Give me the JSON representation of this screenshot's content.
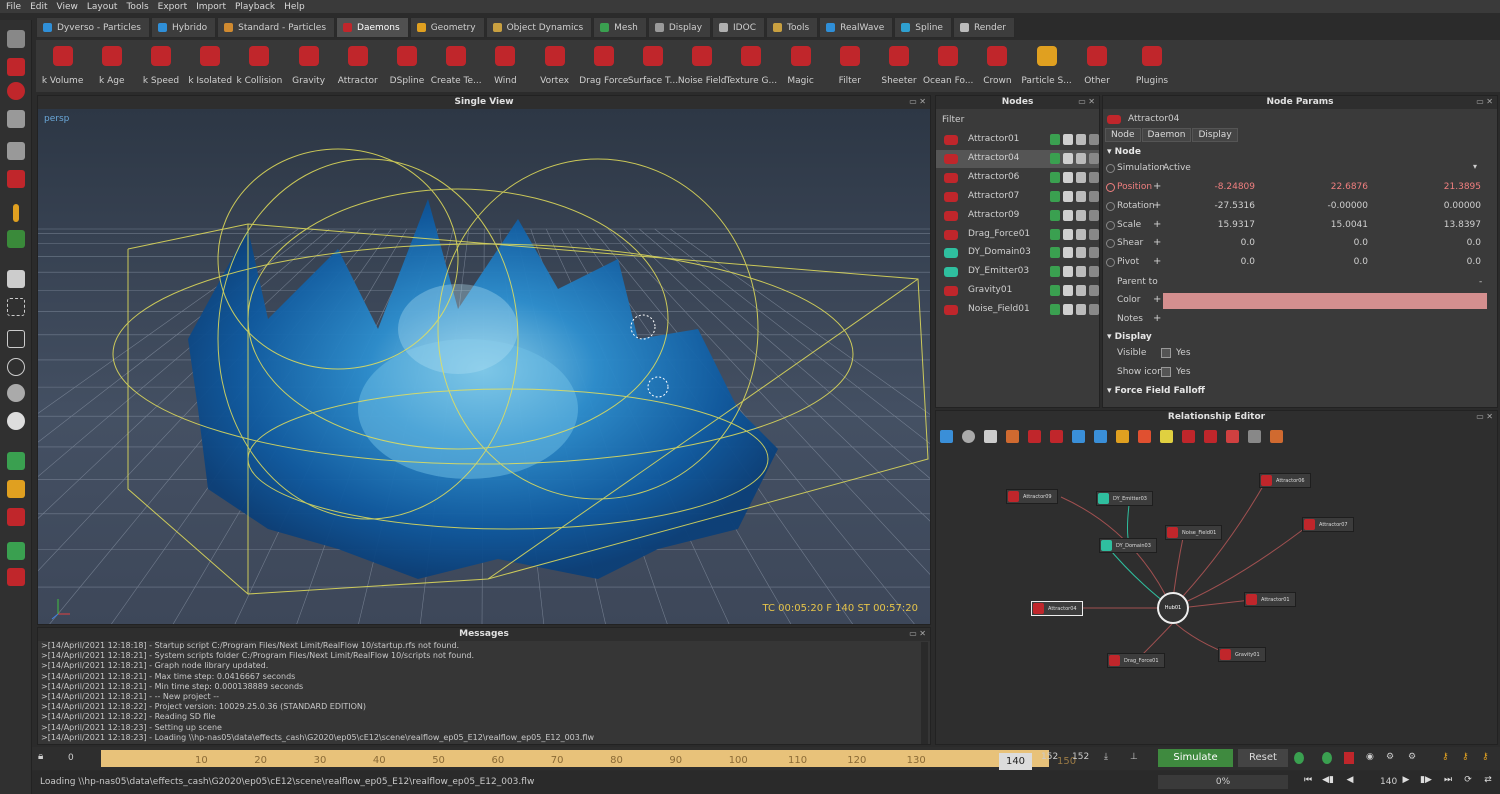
{
  "menu": [
    "File",
    "Edit",
    "View",
    "Layout",
    "Tools",
    "Export",
    "Import",
    "Playback",
    "Help"
  ],
  "shelf_tabs": [
    {
      "label": "Dyverso - Particles",
      "icon": "dyverso-icon",
      "color": "#2f8fd8"
    },
    {
      "label": "Hybrido",
      "icon": "hybrido-icon",
      "color": "#2f8fd8"
    },
    {
      "label": "Standard - Particles",
      "icon": "particles-icon",
      "color": "#d08a30"
    },
    {
      "label": "Daemons",
      "icon": "daemon-icon",
      "color": "#c0262b"
    },
    {
      "label": "Geometry",
      "icon": "geometry-icon",
      "color": "#e0a020"
    },
    {
      "label": "Object Dynamics",
      "icon": "object-dynamics-icon",
      "color": "#c9a040"
    },
    {
      "label": "Mesh",
      "icon": "mesh-icon",
      "color": "#3aa050"
    },
    {
      "label": "Display",
      "icon": "display-icon",
      "color": "#9a9a9a"
    },
    {
      "label": "IDOC",
      "icon": "idoc-icon",
      "color": "#b0b0b0"
    },
    {
      "label": "Tools",
      "icon": "tools-icon",
      "color": "#c9a040"
    },
    {
      "label": "RealWave",
      "icon": "realwave-icon",
      "color": "#2f8fd8"
    },
    {
      "label": "Spline",
      "icon": "spline-icon",
      "color": "#2fa0d0"
    },
    {
      "label": "Render",
      "icon": "render-icon",
      "color": "#bbbbbb"
    }
  ],
  "daemons": [
    "k Volume",
    "k Age",
    "k Speed",
    "k Isolated",
    "k Collision",
    "Gravity",
    "Attractor",
    "DSpline",
    "Create Te...",
    "Wind",
    "Vortex",
    "Drag Force",
    "Surface T...",
    "Noise Field",
    "Texture G...",
    "Magic",
    "Filter",
    "Sheeter",
    "Ocean Fo...",
    "Crown",
    "Particle S...",
    "Other",
    "Plugins"
  ],
  "viewport": {
    "title": "Single View",
    "camera": "persp",
    "timecode": "TC 00:05:20   F 140   ST 00:57:20"
  },
  "nodes": {
    "title": "Nodes",
    "filter_label": "Filter",
    "items": [
      {
        "label": "Attractor01",
        "type": "daemon"
      },
      {
        "label": "Attractor04",
        "type": "daemon",
        "selected": true
      },
      {
        "label": "Attractor06",
        "type": "daemon"
      },
      {
        "label": "Attractor07",
        "type": "daemon"
      },
      {
        "label": "Attractor09",
        "type": "daemon"
      },
      {
        "label": "Drag_Force01",
        "type": "daemon"
      },
      {
        "label": "DY_Domain03",
        "type": "dyverso"
      },
      {
        "label": "DY_Emitter03",
        "type": "dyverso"
      },
      {
        "label": "Gravity01",
        "type": "daemon"
      },
      {
        "label": "Noise_Field01",
        "type": "daemon"
      }
    ]
  },
  "params": {
    "title": "Node Params",
    "node_name": "Attractor04",
    "tabs": [
      "Node",
      "Daemon",
      "Display"
    ],
    "section_node": "Node",
    "simulation_label": "Simulation",
    "simulation_value": "Active",
    "rows": [
      {
        "name": "Position",
        "x": "-8.24809",
        "y": "22.6876",
        "z": "21.3895",
        "keyed": true
      },
      {
        "name": "Rotation",
        "x": "-27.5316",
        "y": "-0.00000",
        "z": "0.00000"
      },
      {
        "name": "Scale",
        "x": "15.9317",
        "y": "15.0041",
        "z": "13.8397"
      },
      {
        "name": "Shear",
        "x": "0.0",
        "y": "0.0",
        "z": "0.0"
      },
      {
        "name": "Pivot",
        "x": "0.0",
        "y": "0.0",
        "z": "0.0"
      }
    ],
    "parent_label": "Parent to",
    "color_label": "Color",
    "color_value": "#d48f8f",
    "notes_label": "Notes",
    "section_display": "Display",
    "visible_label": "Visible",
    "visible_value": "Yes",
    "show_icon_label": "Show icon",
    "show_icon_value": "Yes",
    "section_falloff": "Force Field Falloff"
  },
  "relationship": {
    "title": "Relationship Editor",
    "hub": "Hub01",
    "nodes": [
      {
        "label": "Attractor09",
        "type": "daemon"
      },
      {
        "label": "DY_Emitter03",
        "type": "dyverso"
      },
      {
        "label": "Attractor06",
        "type": "daemon"
      },
      {
        "label": "Noise_Field01",
        "type": "daemon"
      },
      {
        "label": "Attractor07",
        "type": "daemon"
      },
      {
        "label": "DY_Domain03",
        "type": "dyverso"
      },
      {
        "label": "Attractor04",
        "type": "daemon"
      },
      {
        "label": "Attractor01",
        "type": "daemon"
      },
      {
        "label": "Drag_Force01",
        "type": "daemon"
      },
      {
        "label": "Gravity01",
        "type": "daemon"
      }
    ]
  },
  "messages": {
    "title": "Messages",
    "lines": [
      ">[14/April/2021 12:18:18] - Startup script C:/Program Files/Next Limit/RealFlow 10/startup.rfs not found.",
      ">[14/April/2021 12:18:21] - System scripts folder C:/Program Files/Next Limit/RealFlow 10/scripts not found.",
      ">[14/April/2021 12:18:21] - Graph node library updated.",
      ">[14/April/2021 12:18:21] - Max time step: 0.0416667 seconds",
      ">[14/April/2021 12:18:21] - Min time step: 0.000138889 seconds",
      ">[14/April/2021 12:18:21] - -- New project --",
      ">[14/April/2021 12:18:22] - Project version: 10029.25.0.36 (STANDARD EDITION)",
      ">[14/April/2021 12:18:22] - Reading SD file",
      ">[14/April/2021 12:18:23] - Setting up scene",
      ">[14/April/2021 12:18:23] -  Loading \\\\hp-nas05\\data\\effects_cash\\G2020\\ep05\\cE12\\scene\\realflow_ep05_E12\\realflow_ep05_E12_003.flw"
    ]
  },
  "timeline": {
    "start": "0",
    "ticks": [
      "10",
      "20",
      "30",
      "40",
      "50",
      "60",
      "70",
      "80",
      "90",
      "100",
      "110",
      "120",
      "130"
    ],
    "current": "140",
    "end_tick": "150",
    "end_a": "152",
    "end_b": "152",
    "simulate": "Simulate",
    "reset": "Reset"
  },
  "status": {
    "text": "Loading \\\\hp-nas05\\data\\effects_cash\\G2020\\ep05\\cE12\\scene\\realflow_ep05_E12\\realflow_ep05_E12_003.flw",
    "progress": "0%",
    "frame": "140"
  }
}
